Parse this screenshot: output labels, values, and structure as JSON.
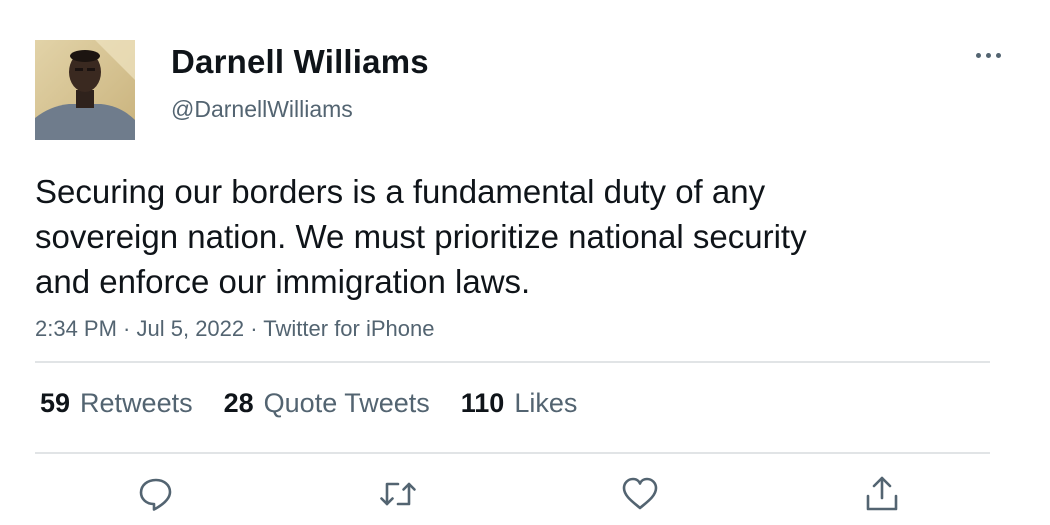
{
  "user": {
    "display_name": "Darnell Williams",
    "handle": "@DarnellWilliams"
  },
  "tweet": {
    "text_lines": [
      "Securing our borders is a fundamental duty of any",
      "sovereign nation. We must prioritize national security",
      "and enforce our immigration laws."
    ],
    "time": "2:34 PM",
    "separator": " · ",
    "date": "Jul 5, 2022",
    "source": "Twitter for iPhone"
  },
  "stats": {
    "retweets": {
      "count": "59",
      "label": "Retweets"
    },
    "quote_tweets": {
      "count": "28",
      "label": "Quote Tweets"
    },
    "likes": {
      "count": "110",
      "label": "Likes"
    }
  },
  "actions": {
    "reply": "reply-icon",
    "retweet": "retweet-icon",
    "like": "heart-icon",
    "share": "share-icon"
  },
  "colors": {
    "text_primary": "#0f1419",
    "text_secondary": "#536471",
    "divider": "#e1e4e6",
    "icon": "#536471"
  }
}
